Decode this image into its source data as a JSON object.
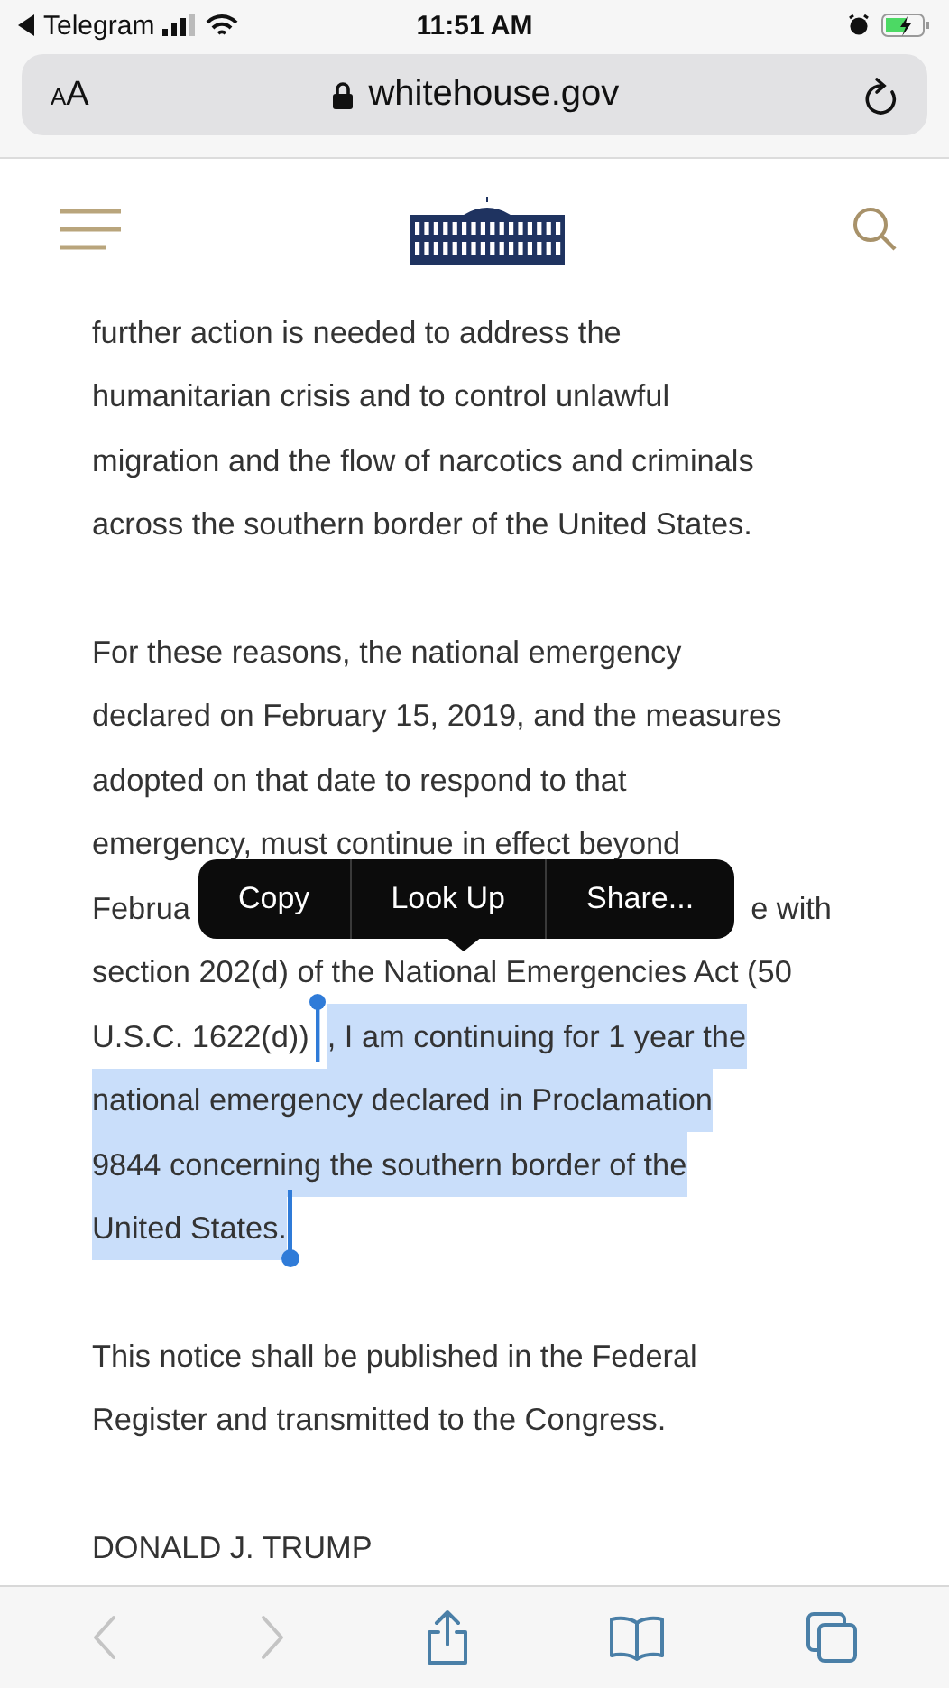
{
  "status_bar": {
    "back_app": "Telegram",
    "time": "11:51 AM"
  },
  "address_bar": {
    "text_size": "AA",
    "url": "whitehouse.gov"
  },
  "article": {
    "paragraphs": [
      {
        "lines": [
          {
            "segments": [
              {
                "text": "further action is needed to address the",
                "selected": false
              }
            ]
          },
          {
            "segments": [
              {
                "text": "humanitarian crisis and to control unlawful",
                "selected": false
              }
            ]
          },
          {
            "segments": [
              {
                "text": "migration and the flow of narcotics and criminals",
                "selected": false
              }
            ]
          },
          {
            "segments": [
              {
                "text": "across the southern border of the United States.",
                "selected": false
              }
            ]
          }
        ]
      },
      {
        "lines": [
          {
            "segments": [
              {
                "text": "For these reasons, the national emergency",
                "selected": false
              }
            ]
          },
          {
            "segments": [
              {
                "text": "declared on February 15, 2019, and the measures",
                "selected": false
              }
            ]
          },
          {
            "segments": [
              {
                "text": "adopted on that date to respond to that",
                "selected": false
              }
            ]
          },
          {
            "segments": [
              {
                "text": "emergency, must continue in effect beyond",
                "selected": false
              }
            ]
          },
          {
            "segments": [
              {
                "text": "Februa",
                "selected": false
              },
              {
                "text": "e with",
                "selected": false
              }
            ]
          },
          {
            "segments": [
              {
                "text": "section 202(d) of the National Emergencies Act (50",
                "selected": false
              }
            ]
          },
          {
            "segments": [
              {
                "text": "U.S.C. 1622(d))",
                "selected": false
              },
              {
                "text": ", I am continuing for 1 year the",
                "selected": true
              }
            ]
          },
          {
            "segments": [
              {
                "text": "national emergency declared in Proclamation",
                "selected": true
              }
            ]
          },
          {
            "segments": [
              {
                "text": "9844 concerning the southern border of the",
                "selected": true
              }
            ]
          },
          {
            "segments": [
              {
                "text": "United States.",
                "selected": true
              }
            ]
          }
        ]
      },
      {
        "lines": [
          {
            "segments": [
              {
                "text": "This notice shall be published in the Federal",
                "selected": false
              }
            ]
          },
          {
            "segments": [
              {
                "text": "Register and transmitted to the Congress.",
                "selected": false
              }
            ]
          }
        ]
      },
      {
        "lines": [
          {
            "segments": [
              {
                "text": "DONALD J. TRUMP",
                "selected": false
              }
            ]
          }
        ]
      }
    ]
  },
  "context_menu": {
    "items": [
      "Copy",
      "Look Up",
      "Share..."
    ]
  },
  "toolbar": [
    {
      "kind": "back",
      "disabled": true
    },
    {
      "kind": "forward",
      "disabled": true
    },
    {
      "kind": "share",
      "disabled": false
    },
    {
      "kind": "bookmarks",
      "disabled": false
    },
    {
      "kind": "tabs",
      "disabled": false
    }
  ]
}
